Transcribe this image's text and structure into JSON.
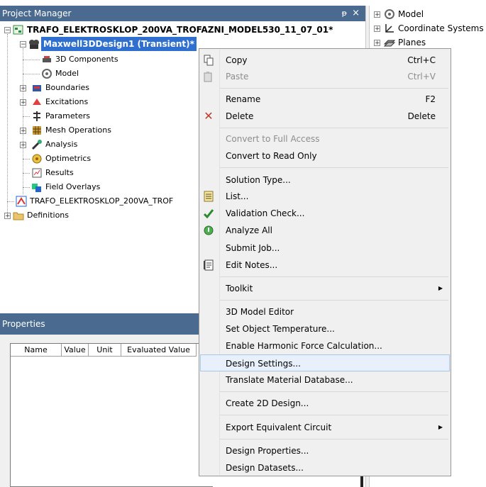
{
  "project_manager": {
    "title": "Project Manager",
    "pin_glyph": "ᵽ",
    "close_glyph": "×",
    "root": "TRAFO_ELEKTROSKLOP_200VA_TROFAZNI_MODEL530_11_07_01*",
    "design": "Maxwell3DDesign1 (Transient)*",
    "children": [
      "3D Components",
      "Model",
      "Boundaries",
      "Excitations",
      "Parameters",
      "Mesh Operations",
      "Analysis",
      "Optimetrics",
      "Results",
      "Field Overlays"
    ],
    "sibling": "TRAFO_ELEKTROSKLOP_200VA_TROF",
    "definitions": "Definitions"
  },
  "model_tree": {
    "items": [
      "Model",
      "Coordinate Systems",
      "Planes"
    ]
  },
  "properties": {
    "title": "Properties",
    "columns": [
      "Name",
      "Value",
      "Unit",
      "Evaluated Value"
    ]
  },
  "context_menu": {
    "copy": {
      "label": "Copy",
      "shortcut": "Ctrl+C"
    },
    "paste": {
      "label": "Paste",
      "shortcut": "Ctrl+V"
    },
    "rename": {
      "label": "Rename",
      "shortcut": "F2"
    },
    "delete": {
      "label": "Delete",
      "shortcut": "Delete"
    },
    "convert_full": "Convert to Full Access",
    "convert_read": "Convert to Read Only",
    "solution_type": "Solution Type...",
    "list": "List...",
    "validation": "Validation Check...",
    "analyze_all": "Analyze All",
    "submit_job": "Submit Job...",
    "edit_notes": "Edit Notes...",
    "toolkit": "Toolkit",
    "model_editor": "3D Model Editor",
    "set_temp": "Set Object Temperature...",
    "harmonic": "Enable Harmonic Force Calculation...",
    "design_settings": "Design Settings...",
    "translate_db": "Translate Material Database...",
    "create_2d": "Create 2D Design...",
    "export_circuit": "Export Equivalent Circuit",
    "design_props": "Design Properties...",
    "design_datasets": "Design Datasets..."
  },
  "colors": {
    "panel_title_bg": "#4a6b8f",
    "selection_bg": "#2f6fd0",
    "menu_bg": "#f0f0f0",
    "menu_highlight": "#e8f0fb",
    "delete_icon": "#c0392b"
  }
}
